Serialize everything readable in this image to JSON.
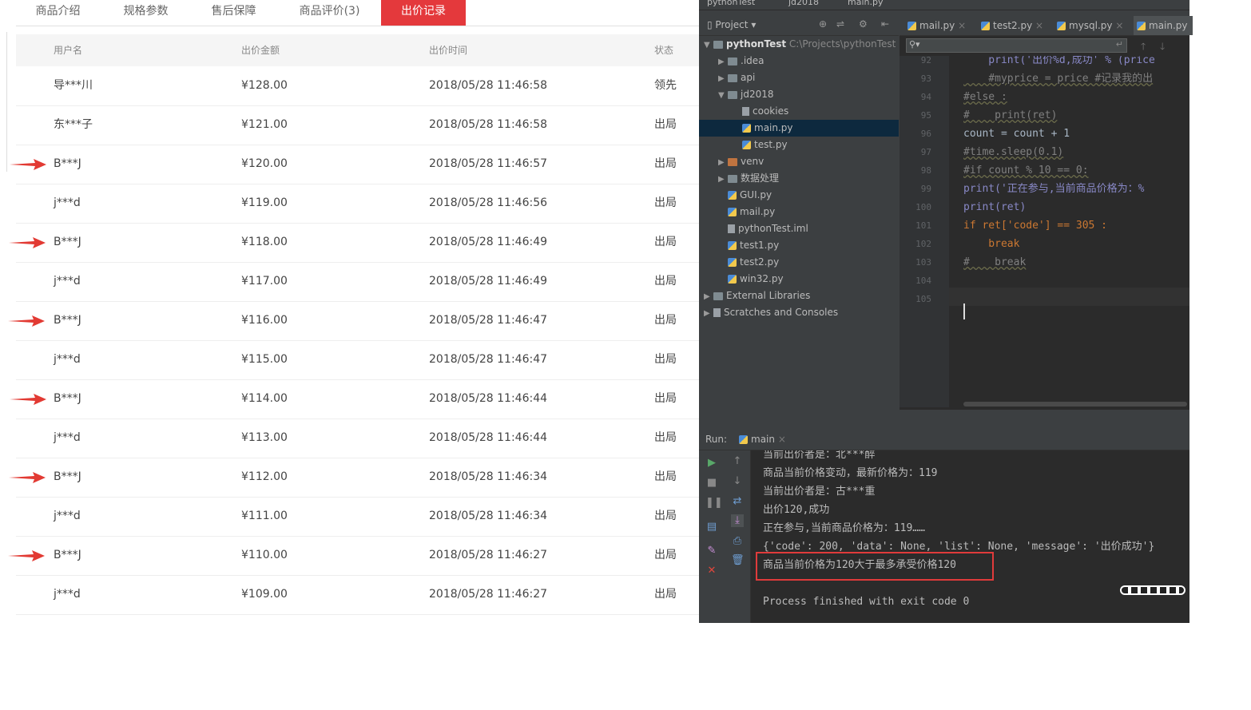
{
  "web": {
    "tabs": [
      {
        "label": "商品介绍",
        "active": false
      },
      {
        "label": "规格参数",
        "active": false
      },
      {
        "label": "售后保障",
        "active": false
      },
      {
        "label": "商品评价(3)",
        "active": false
      },
      {
        "label": "出价记录",
        "active": true
      }
    ],
    "columns": {
      "user": "用户名",
      "amount": "出价金额",
      "time": "出价时间",
      "status": "状态"
    },
    "rows": [
      {
        "user": "导***川",
        "amount": "¥128.00",
        "time": "2018/05/28 11:46:58",
        "status": "领先",
        "arrow": false
      },
      {
        "user": "东***子",
        "amount": "¥121.00",
        "time": "2018/05/28 11:46:58",
        "status": "出局",
        "arrow": false
      },
      {
        "user": "B***J",
        "amount": "¥120.00",
        "time": "2018/05/28 11:46:57",
        "status": "出局",
        "arrow": true
      },
      {
        "user": "j***d",
        "amount": "¥119.00",
        "time": "2018/05/28 11:46:56",
        "status": "出局",
        "arrow": false
      },
      {
        "user": "B***J",
        "amount": "¥118.00",
        "time": "2018/05/28 11:46:49",
        "status": "出局",
        "arrow": true
      },
      {
        "user": "j***d",
        "amount": "¥117.00",
        "time": "2018/05/28 11:46:49",
        "status": "出局",
        "arrow": false
      },
      {
        "user": "B***J",
        "amount": "¥116.00",
        "time": "2018/05/28 11:46:47",
        "status": "出局",
        "arrow": true
      },
      {
        "user": "j***d",
        "amount": "¥115.00",
        "time": "2018/05/28 11:46:47",
        "status": "出局",
        "arrow": false
      },
      {
        "user": "B***J",
        "amount": "¥114.00",
        "time": "2018/05/28 11:46:44",
        "status": "出局",
        "arrow": true
      },
      {
        "user": "j***d",
        "amount": "¥113.00",
        "time": "2018/05/28 11:46:44",
        "status": "出局",
        "arrow": false
      },
      {
        "user": "B***J",
        "amount": "¥112.00",
        "time": "2018/05/28 11:46:34",
        "status": "出局",
        "arrow": true
      },
      {
        "user": "j***d",
        "amount": "¥111.00",
        "time": "2018/05/28 11:46:34",
        "status": "出局",
        "arrow": false
      },
      {
        "user": "B***J",
        "amount": "¥110.00",
        "time": "2018/05/28 11:46:27",
        "status": "出局",
        "arrow": true
      },
      {
        "user": "j***d",
        "amount": "¥109.00",
        "time": "2018/05/28 11:46:27",
        "status": "出局",
        "arrow": false
      }
    ],
    "accent": "#e4393c"
  },
  "ide": {
    "breadcrumbs": [
      "pythonTest",
      "jd2018",
      "main.py"
    ],
    "project_label": "Project",
    "tree": [
      {
        "label": "pythonTest",
        "path": "C:\\Projects\\pythonTest",
        "kind": "root",
        "expanded": true,
        "depth": 0
      },
      {
        "label": ".idea",
        "kind": "folder",
        "expanded": false,
        "depth": 1
      },
      {
        "label": "api",
        "kind": "folder",
        "expanded": false,
        "depth": 1
      },
      {
        "label": "jd2018",
        "kind": "folder",
        "expanded": true,
        "depth": 1
      },
      {
        "label": "cookies",
        "kind": "file",
        "depth": 2
      },
      {
        "label": "main.py",
        "kind": "py",
        "depth": 2,
        "selected": true
      },
      {
        "label": "test.py",
        "kind": "py",
        "depth": 2
      },
      {
        "label": "venv",
        "kind": "folder-excluded",
        "expanded": false,
        "depth": 1
      },
      {
        "label": "数据处理",
        "kind": "folder",
        "expanded": false,
        "depth": 1
      },
      {
        "label": "GUI.py",
        "kind": "py",
        "depth": 1
      },
      {
        "label": "mail.py",
        "kind": "py",
        "depth": 1
      },
      {
        "label": "pythonTest.iml",
        "kind": "file",
        "depth": 1
      },
      {
        "label": "test1.py",
        "kind": "py",
        "depth": 1
      },
      {
        "label": "test2.py",
        "kind": "py",
        "depth": 1
      },
      {
        "label": "win32.py",
        "kind": "py",
        "depth": 1
      },
      {
        "label": "External Libraries",
        "kind": "lib",
        "expanded": false,
        "depth": 0
      },
      {
        "label": "Scratches and Consoles",
        "kind": "scratch",
        "expanded": false,
        "depth": 0
      }
    ],
    "editor_tabs": [
      {
        "label": "mail.py",
        "active": false
      },
      {
        "label": "test2.py",
        "active": false
      },
      {
        "label": "mysql.py",
        "active": false
      },
      {
        "label": "main.py",
        "active": true
      }
    ],
    "search_placeholder": "",
    "lines": [
      {
        "n": "92",
        "text": "    print('出价%d,成功' % (price"
      },
      {
        "n": "93",
        "text": "    #myprice = price #记录我的出"
      },
      {
        "n": "94",
        "text": "#else :"
      },
      {
        "n": "95",
        "text": "#    print(ret)"
      },
      {
        "n": "96",
        "text": "count = count + 1"
      },
      {
        "n": "97",
        "text": "#time.sleep(0.1)"
      },
      {
        "n": "98",
        "text": "#if count % 10 == 0:"
      },
      {
        "n": "99",
        "text": "print('正在参与,当前商品价格为：%"
      },
      {
        "n": "100",
        "text": "print(ret)"
      },
      {
        "n": "101",
        "text": "if ret['code'] == 305 :"
      },
      {
        "n": "102",
        "text": "    break"
      },
      {
        "n": "103",
        "text": "#    break"
      },
      {
        "n": "104",
        "text": ""
      },
      {
        "n": "105",
        "text": ""
      }
    ],
    "run_label": "Run:",
    "run_config": "main",
    "console": [
      "当前出价者是：北***醉",
      "商品当前价格变动，最新价格为：119",
      "当前出价者是：古***重",
      "出价120,成功",
      "正在参与,当前商品价格为：119……",
      "{'code': 200, 'data': None, 'list': None, 'message': '出价成功'}",
      "商品当前价格为120大于最多承受价格120",
      "",
      "Process finished with exit code 0"
    ]
  }
}
